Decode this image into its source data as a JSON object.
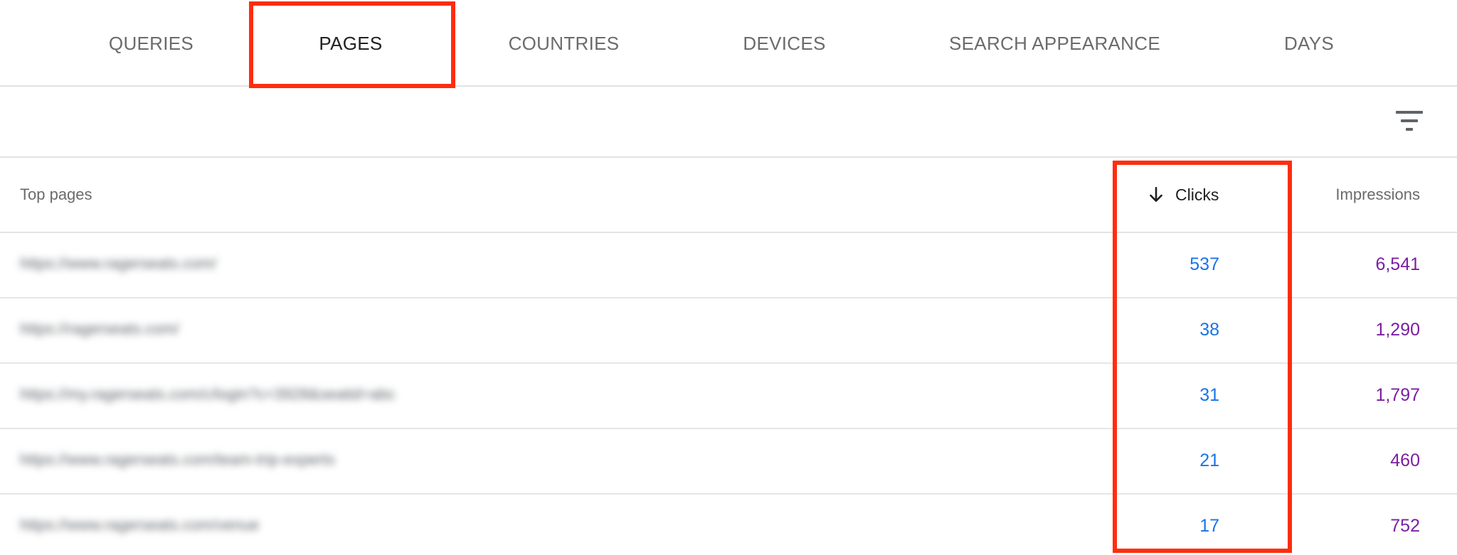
{
  "tabs": [
    {
      "label": "QUERIES",
      "active": false
    },
    {
      "label": "PAGES",
      "active": true
    },
    {
      "label": "COUNTRIES",
      "active": false
    },
    {
      "label": "DEVICES",
      "active": false
    },
    {
      "label": "SEARCH APPEARANCE",
      "active": false
    },
    {
      "label": "DAYS",
      "active": false
    }
  ],
  "toolbar": {
    "filter_icon": "filter-list-icon"
  },
  "table": {
    "headers": {
      "pages": "Top pages",
      "clicks": "Clicks",
      "impressions": "Impressions"
    },
    "sort_icon": "arrow-down-icon",
    "rows": [
      {
        "page": "https://www.ragerseats.com/",
        "clicks": "537",
        "impressions": "6,541"
      },
      {
        "page": "https://ragerseats.com/",
        "clicks": "38",
        "impressions": "1,290"
      },
      {
        "page": "https://my.ragerseats.com/c/login?c=3928&seatid=abc",
        "clicks": "31",
        "impressions": "1,797"
      },
      {
        "page": "https://www.ragerseats.com/team-trip-experts",
        "clicks": "21",
        "impressions": "460"
      },
      {
        "page": "https://www.ragerseats.com/venue",
        "clicks": "17",
        "impressions": "752"
      }
    ]
  },
  "colors": {
    "clicks_value": "#1a73e8",
    "impressions_value": "#7b1fa2",
    "highlight": "#ff2d0f"
  }
}
